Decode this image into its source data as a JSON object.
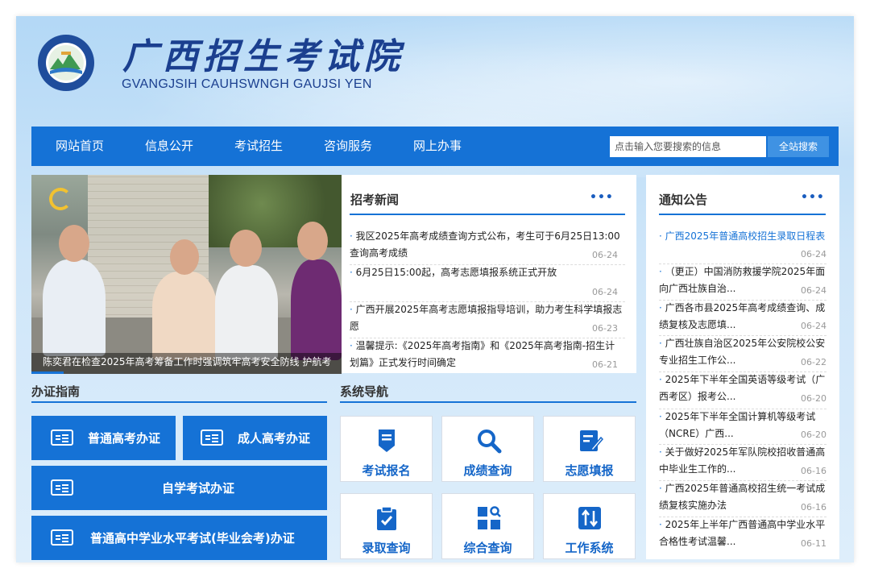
{
  "header": {
    "title": "广西招生考试院",
    "subtitle": "GVANGJSIH CAUHSWNGH GAUJSI YEN"
  },
  "nav": {
    "items": [
      "网站首页",
      "信息公开",
      "考试招生",
      "咨询服务",
      "网上办事"
    ],
    "search_placeholder": "点击输入您要搜索的信息",
    "search_button": "全站搜索"
  },
  "photo": {
    "caption": "陈奕君在检查2025年高考筹备工作时强调筑牢高考安全防线 护航考"
  },
  "news": {
    "title": "招考新闻",
    "more": "•••",
    "items": [
      {
        "text": "我区2025年高考成绩查询方式公布，考生可于6月25日13:00查询高考成绩",
        "date": "06-24"
      },
      {
        "text": "6月25日15:00起，高考志愿填报系统正式开放",
        "date": "06-24"
      },
      {
        "text": "广西开展2025年高考志愿填报指导培训，助力考生科学填报志愿",
        "date": "06-23"
      },
      {
        "text": "温馨提示:《2025年高考指南》和《2025年高考指南-招生计划篇》正式发行时间确定",
        "date": "06-21"
      }
    ]
  },
  "notice": {
    "title": "通知公告",
    "more": "•••",
    "items": [
      {
        "text": "广西2025年普通高校招生录取日程表",
        "date": "06-24"
      },
      {
        "text": "（更正）中国消防救援学院2025年面向广西壮族自治...",
        "date": "06-24"
      },
      {
        "text": "广西各市县2025年高考成绩查询、成绩复核及志愿填...",
        "date": "06-24"
      },
      {
        "text": "广西壮族自治区2025年公安院校公安专业招生工作公...",
        "date": "06-22"
      },
      {
        "text": "2025年下半年全国英语等级考试（广西考区）报考公...",
        "date": "06-20"
      },
      {
        "text": "2025年下半年全国计算机等级考试（NCRE）广西...",
        "date": "06-20"
      },
      {
        "text": "关于做好2025年军队院校招收普通高中毕业生工作的...",
        "date": "06-16"
      },
      {
        "text": "广西2025年普通高校招生统一考试成绩复核实施办法",
        "date": "06-16"
      },
      {
        "text": "2025年上半年广西普通高中学业水平合格性考试温馨...",
        "date": "06-11"
      }
    ]
  },
  "guide": {
    "title": "办证指南",
    "buttons": [
      "普通高考办证",
      "成人高考办证",
      "自学考试办证",
      "普通高中学业水平考试(毕业会考)办证"
    ]
  },
  "system_nav": {
    "title": "系统导航",
    "tiles": [
      {
        "label": "考试报名",
        "icon": "exam-register-icon"
      },
      {
        "label": "成绩查询",
        "icon": "search-icon"
      },
      {
        "label": "志愿填报",
        "icon": "edit-form-icon"
      },
      {
        "label": "录取查询",
        "icon": "clipboard-check-icon"
      },
      {
        "label": "综合查询",
        "icon": "grid-search-icon"
      },
      {
        "label": "工作系统",
        "icon": "sliders-icon"
      }
    ]
  },
  "colors": {
    "primary": "#1572d6",
    "title": "#1b3f8f",
    "date": "#999999"
  }
}
